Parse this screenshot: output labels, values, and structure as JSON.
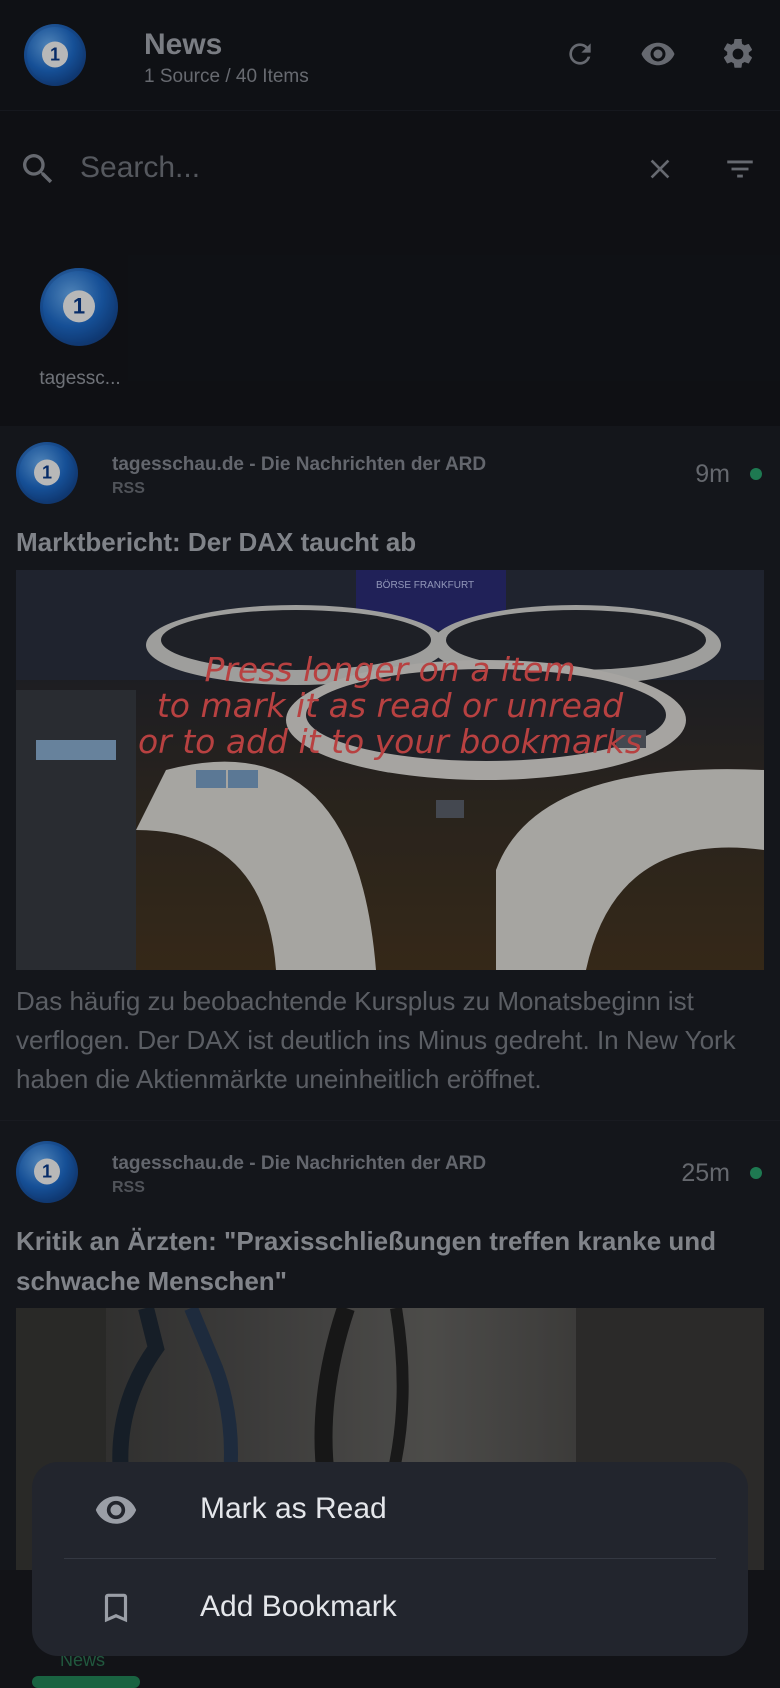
{
  "header": {
    "title": "News",
    "subtitle": "1 Source / 40 Items",
    "icons": [
      "refresh-icon",
      "eye-icon",
      "gear-icon"
    ]
  },
  "search": {
    "placeholder": "Search...",
    "icons": [
      "search-icon",
      "close-icon",
      "filter-icon"
    ]
  },
  "sources": [
    {
      "label": "tagessc..."
    }
  ],
  "items": [
    {
      "source": "tagesschau.de - Die Nachrichten der ARD",
      "type": "RSS",
      "time": "9m",
      "title": "Marktbericht: Der DAX taucht ab",
      "description": "Das häufig zu beobachtende Kursplus zu Monatsbeginn ist verflogen. Der DAX ist deutlich ins Minus gedreht. In New York haben die Aktienmärkte uneinheitlich eröffnet.",
      "image_caption": "BÖRSE FRANKFURT"
    },
    {
      "source": "tagesschau.de - Die Nachrichten der ARD",
      "type": "RSS",
      "time": "25m",
      "title": "Kritik an Ärzten: \"Praxisschließungen treffen kranke und schwache Menschen\"",
      "description": ""
    }
  ],
  "hint": {
    "line1": "Press longer on a item",
    "line2": "to mark it as read or unread",
    "line3": "or to add it to your bookmarks"
  },
  "bottom_nav": {
    "label": "News"
  },
  "sheet": {
    "mark_read": "Mark as Read",
    "add_bookmark": "Add Bookmark"
  },
  "colors": {
    "accent": "#2aa871",
    "hint": "#ff5a5a",
    "background": "#1c1f26"
  }
}
